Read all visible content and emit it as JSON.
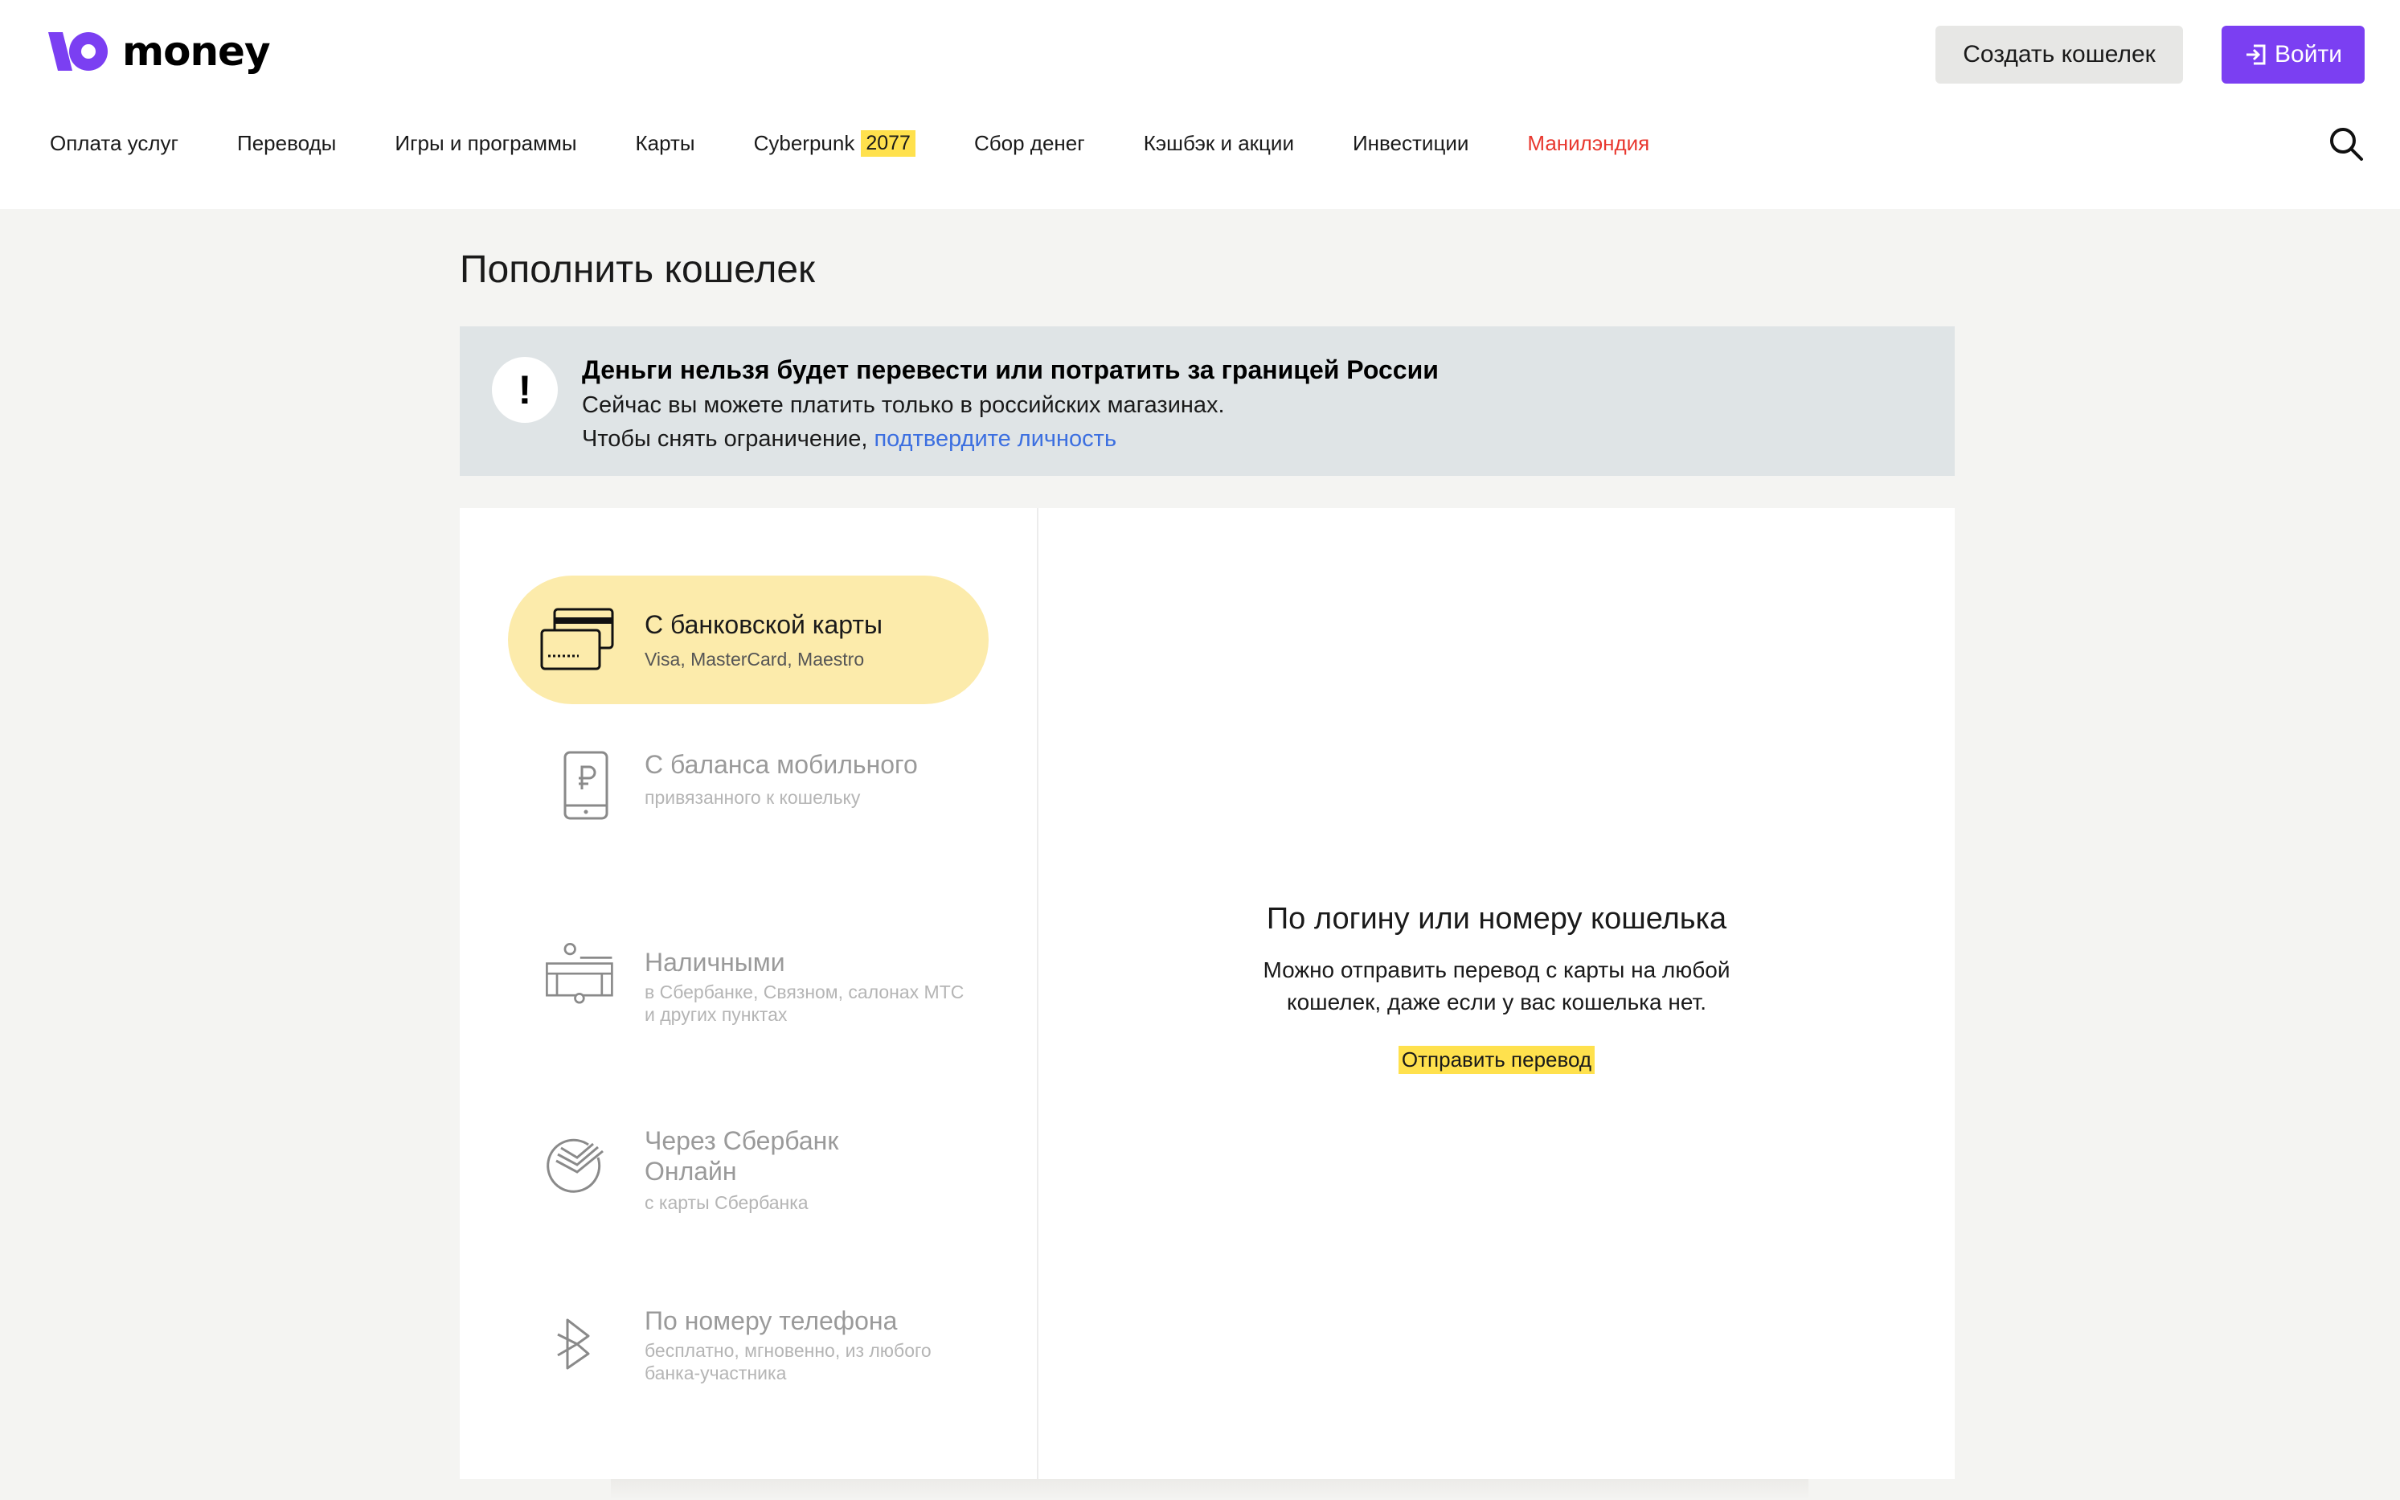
{
  "header": {
    "logo_text": "money",
    "create_wallet": "Создать кошелек",
    "login": "Войти",
    "accent_color": "#7b3ff2"
  },
  "nav": {
    "items": [
      {
        "label": "Оплата услуг"
      },
      {
        "label": "Переводы"
      },
      {
        "label": "Игры и программы"
      },
      {
        "label": "Карты"
      },
      {
        "label": "Cyberpunk",
        "badge": "2077"
      },
      {
        "label": "Сбор денег"
      },
      {
        "label": "Кэшбэк и акции"
      },
      {
        "label": "Инвестиции"
      },
      {
        "label": "Манилэндия",
        "color": "#e8372e"
      }
    ]
  },
  "page": {
    "title": "Пополнить кошелек"
  },
  "alert": {
    "icon": "!",
    "title": "Деньги нельзя будет перевести или потратить за границей России",
    "line1": "Сейчас вы можете платить только в российских магазинах.",
    "line2_prefix": "Чтобы снять ограничение, ",
    "line2_link": "подтвердите личность"
  },
  "methods": [
    {
      "title": "С банковской карты",
      "subtitle": "Visa, MasterCard, Maestro",
      "icon": "bank-card-icon",
      "active": true
    },
    {
      "title": "С баланса мобильного",
      "subtitle": "привязанного к кошельку",
      "icon": "mobile-ruble-icon",
      "active": false
    },
    {
      "title": "Наличными",
      "subtitle": "в Сбербанке, Связном, салонах МТС и других пунктах",
      "icon": "cash-terminal-icon",
      "active": false
    },
    {
      "title": "Через Сбербанк Онлайн",
      "subtitle": "с карты Сбербанка",
      "icon": "sberbank-icon",
      "active": false
    },
    {
      "title": "По номеру телефона",
      "subtitle": "бесплатно, мгновенно, из любого банка-участника",
      "icon": "sbp-icon",
      "active": false
    }
  ],
  "right": {
    "title": "По логину или номеру кошелька",
    "description": "Можно отправить перевод с карты на любой кошелек, даже если у вас кошелька нет.",
    "action": "Отправить перевод"
  }
}
